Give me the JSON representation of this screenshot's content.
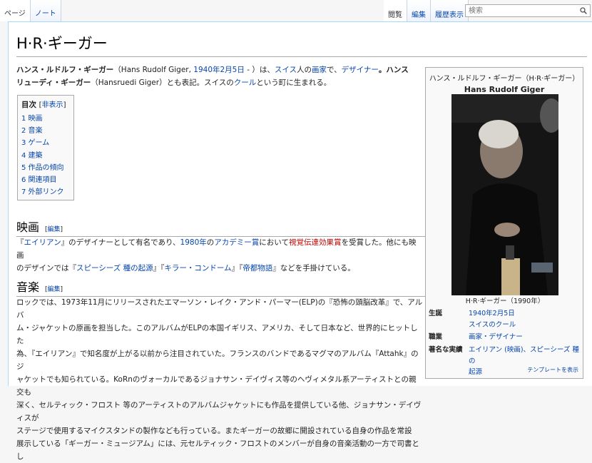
{
  "tabs": {
    "page": "ページ",
    "talk": "ノート",
    "read": "閲覧",
    "edit": "編集",
    "history": "履歴表示"
  },
  "search": {
    "placeholder": "検索"
  },
  "title": "H·R·ギーガー",
  "lead": {
    "name_jp": "ハンス・ルドルフ・ギーガー",
    "name_en": "（Hans Rudolf Giger, ",
    "birthdate": "1940年2月5日",
    "dash": " - ）は、",
    "swiss": "スイス",
    "jin": "人の",
    "painter": "画家",
    "de": "で、",
    "designer": "デザイナー",
    "rest1": "。ハンス",
    "line2_bold": "リューディ・ギーガー",
    "line2a": "（Hansruedi Giger）とも表記。スイスの",
    "chur": "クール",
    "line2b": "という町に生まれる。"
  },
  "toc": {
    "title": "目次",
    "toggle": "非表示",
    "items": [
      "1 映画",
      "2 音楽",
      "3 ゲーム",
      "4 建築",
      "5 作品の傾向",
      "6 関連項目",
      "7 外部リンク"
    ]
  },
  "sections": {
    "edit_label": "編集",
    "eiga": {
      "title": "映画",
      "l1a": "『",
      "alien": "エイリアン",
      "l1b": "』のデザイナーとして有名であり、",
      "y1980": "1980年",
      "l1c": "の",
      "academy": "アカデミー賞",
      "l1d": "において",
      "vfx": "視覚伝達効果賞",
      "l1e": "を受賞した。他にも映画",
      "l2a": "のデザインでは『",
      "species": "スピーシーズ 種の起源",
      "l2b": "』『",
      "killer": "キラー・コンドーム",
      "l2c": "』『",
      "imperial": "帝都物語",
      "l2d": "』などを手掛けている。"
    },
    "ongaku": {
      "title": "音楽",
      "lines": [
        "ロックでは、1973年11月にリリースされたエマーソン・レイク・アンド・パーマー(ELP)の『恐怖の頭脳改革』で、アルバ",
        "ム・ジャケットの原画を担当した。このアルバムがELPの本国イギリス、アメリカ、そして日本など、世界的にヒットした",
        "為、『エイリアン』で知名度が上がる以前から注目されていた。フランスのバンドであるマグマのアルバム『Attahk』のジ",
        "ャケットでも知られている。KoRnのヴォーカルであるジョナサン・デイヴィス等のヘヴィメタル系アーティストとの親交も",
        "深く、セルティック・フロスト 等のアーティストのアルバムジャケットにも作品を提供している他、ジョナサン・デイヴィスが",
        "ステージで使用するマイクスタンドの製作なども行っている。またギーガーの故郷に開設されている自身の作品を常設",
        "展示している「ギーガー・ミュージアム」には、元セルティック・フロストのメンバーが自身の音楽活動の一方で司書とし"
      ]
    }
  },
  "infobox": {
    "title": "ハンス・ルドルフ・ギーガー（H·R·ギーガー）",
    "name": "Hans Rudolf Giger",
    "caption": "H·R·ギーガー（1990年）",
    "rows": [
      {
        "key": "生誕",
        "v1": "1940年2月5日",
        "v2": "スイスのクール"
      },
      {
        "key": "職業",
        "v1": "画家・デザイナー"
      },
      {
        "key": "著名な実績",
        "v1": "エイリアン (映画)、スピーシーズ 種の",
        "v2": "起源"
      }
    ],
    "footer": "テンプレートを表示"
  },
  "colors": {
    "link": "#0645ad",
    "redlink": "#ba0000",
    "border": "#a7d7f9"
  }
}
